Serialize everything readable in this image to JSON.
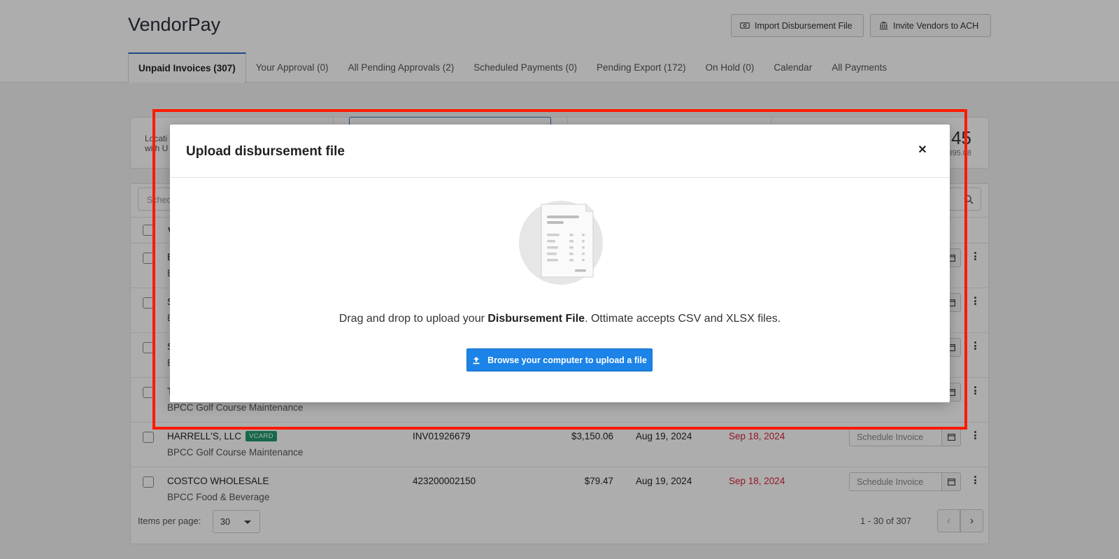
{
  "app": {
    "title": "VendorPay"
  },
  "header_buttons": {
    "import_label": "Import Disbursement File",
    "invite_label": "Invite Vendors to ACH"
  },
  "tabs": [
    {
      "label": "Unpaid Invoices (307)",
      "active": true
    },
    {
      "label": "Your Approval (0)"
    },
    {
      "label": "All Pending Approvals (2)"
    },
    {
      "label": "Scheduled Payments (0)"
    },
    {
      "label": "Pending Export (172)"
    },
    {
      "label": "On Hold (0)"
    },
    {
      "label": "Calendar"
    },
    {
      "label": "All Payments"
    }
  ],
  "summary": {
    "label_line1": "Locati",
    "label_line2": "with U",
    "value_partial": "45",
    "sub_partial": "395.08"
  },
  "table": {
    "search_partial": "Sched",
    "header_partial": "V",
    "rows": [
      {
        "vendor": "B",
        "dept": "B"
      },
      {
        "vendor": "S",
        "dept": "B"
      },
      {
        "vendor": "S",
        "dept": "B"
      },
      {
        "vendor": "T",
        "dept": "BPCC Golf Course Maintenance"
      },
      {
        "vendor": "HARRELL'S, LLC",
        "badge": "VCARD",
        "dept": "BPCC Golf Course Maintenance",
        "invoice": "INV01926679",
        "amount": "$3,150.06",
        "invoice_date": "Aug 19, 2024",
        "due_date": "Sep 18, 2024",
        "schedule_placeholder": "Schedule Invoice"
      },
      {
        "vendor": "COSTCO WHOLESALE",
        "dept": "BPCC Food & Beverage",
        "invoice": "423200002150",
        "amount": "$79.47",
        "invoice_date": "Aug 19, 2024",
        "due_date": "Sep 18, 2024",
        "schedule_placeholder": "Schedule Invoice"
      }
    ],
    "footer": {
      "items_per_page_label": "Items per page:",
      "items_per_page_value": "30",
      "range": "1 - 30 of 307"
    }
  },
  "modal": {
    "title": "Upload disbursement file",
    "close_icon": "close-icon",
    "message_prefix": "Drag and drop to upload your ",
    "message_bold": "Disbursement File",
    "message_suffix": ". Ottimate accepts CSV and XLSX files.",
    "browse_label": "Browse your computer to upload a file"
  },
  "colors": {
    "accent": "#1c83e8",
    "due_red": "#d9243a",
    "badge_green": "#1f9b6e",
    "highlight_red": "#ff1a00"
  }
}
